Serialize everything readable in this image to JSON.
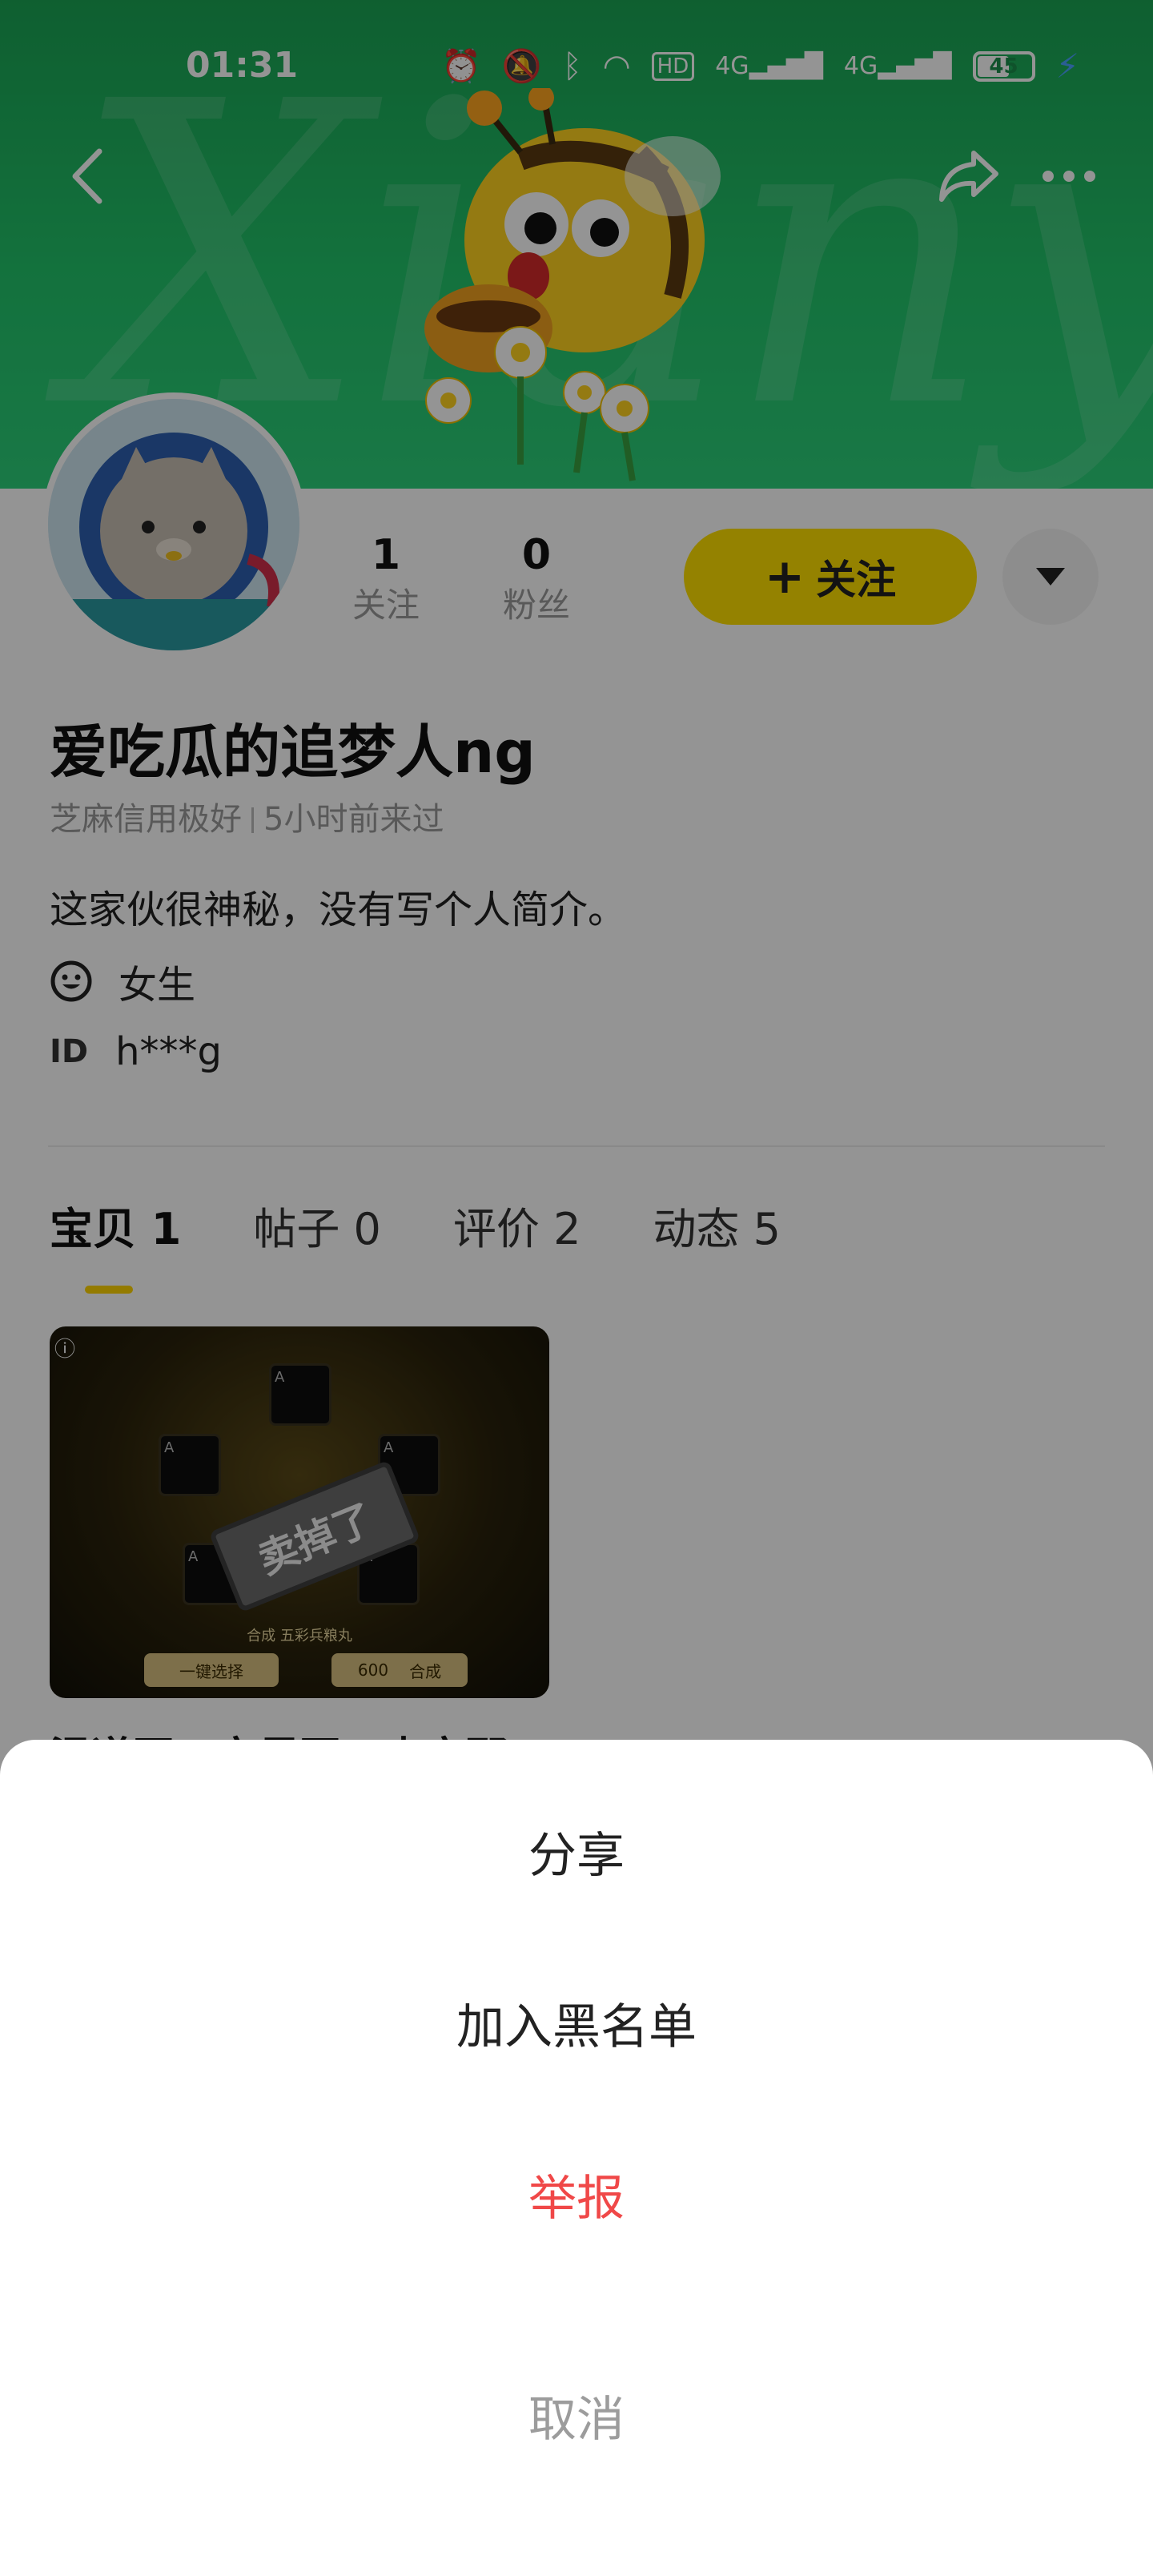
{
  "status_bar": {
    "time": "01:31",
    "network_labels": [
      "HD",
      "4G",
      "4G"
    ],
    "battery": "45"
  },
  "banner": {
    "watermark": "Xianyu",
    "accent_color": "#22c46a"
  },
  "profile": {
    "following_count": "1",
    "following_label": "关注",
    "followers_count": "0",
    "followers_label": "粉丝",
    "follow_button": "关注",
    "nickname": "爱吃瓜的追梦人ng",
    "credit": "芝麻信用极好",
    "last_seen": "5小时前来过",
    "bio": "这家伙很神秘，没有写个人简介。",
    "gender": "女生",
    "id_label": "ID",
    "id_value": "h***g"
  },
  "tabs": [
    {
      "label": "宝贝 1",
      "active": true
    },
    {
      "label": "帖子 0",
      "active": false
    },
    {
      "label": "评价 2",
      "active": false
    },
    {
      "label": "动态 5",
      "active": false
    }
  ],
  "product": {
    "sold_stamp": "卖掉了",
    "caption": "合成  五彩兵粮丸",
    "button_left": "一键选择",
    "cost": "600",
    "button_right": "合成",
    "title": "温道至一完尽至一本完那"
  },
  "sheet": {
    "share": "分享",
    "blacklist": "加入黑名单",
    "report": "举报",
    "cancel": "取消",
    "report_color": "#f04848"
  }
}
